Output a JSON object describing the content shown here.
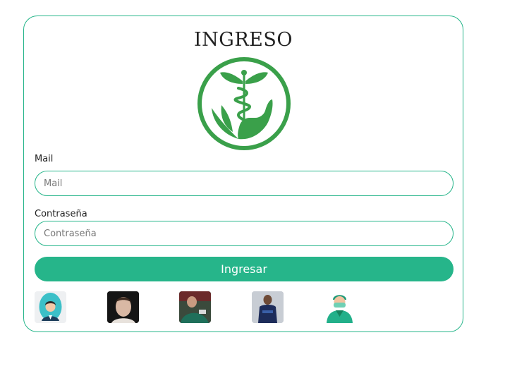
{
  "login": {
    "title": "INGRESO",
    "mail_label": "Mail",
    "mail_placeholder": "Mail",
    "password_label": "Contraseña",
    "password_placeholder": "Contraseña",
    "submit_label": "Ingresar"
  },
  "logo": {
    "icon": "caduceus-hand-leaf-logo"
  },
  "avatars": [
    {
      "icon": "user-avatar-icon"
    },
    {
      "icon": "user-photo"
    },
    {
      "icon": "user-photo"
    },
    {
      "icon": "user-photo"
    },
    {
      "icon": "surgeon-avatar-icon"
    }
  ],
  "colors": {
    "accent": "#26b58a",
    "logo_green": "#3aa04a"
  }
}
